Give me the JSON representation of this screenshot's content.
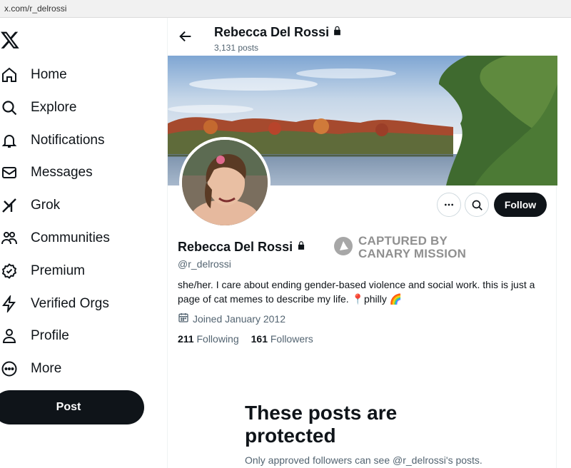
{
  "browser": {
    "url": "x.com/r_delrossi"
  },
  "sidebar": {
    "logo": "x-logo-icon",
    "items": [
      {
        "label": "Home",
        "icon": "home-icon"
      },
      {
        "label": "Explore",
        "icon": "search-icon"
      },
      {
        "label": "Notifications",
        "icon": "bell-icon"
      },
      {
        "label": "Messages",
        "icon": "envelope-icon"
      },
      {
        "label": "Grok",
        "icon": "grok-icon"
      },
      {
        "label": "Communities",
        "icon": "people-icon"
      },
      {
        "label": "Premium",
        "icon": "verified-badge-icon"
      },
      {
        "label": "Verified Orgs",
        "icon": "lightning-icon"
      },
      {
        "label": "Profile",
        "icon": "person-icon"
      },
      {
        "label": "More",
        "icon": "more-circle-icon"
      }
    ],
    "post_label": "Post"
  },
  "header": {
    "name": "Rebecca Del Rossi",
    "post_count": "3,131 posts"
  },
  "profile": {
    "display_name": "Rebecca Del Rossi",
    "handle": "@r_delrossi",
    "bio": "she/her. I care about ending gender-based violence and social work. this is just a page of cat memes to describe my life. 📍philly 🌈",
    "joined": "Joined January 2012",
    "following_count": "211",
    "following_label": "Following",
    "followers_count": "161",
    "followers_label": "Followers",
    "follow_label": "Follow"
  },
  "watermark": {
    "line1": "CAPTURED BY",
    "line2": "CANARY MISSION"
  },
  "protected": {
    "title": "These posts are protected",
    "subtitle": "Only approved followers can see @r_delrossi's posts."
  },
  "colors": {
    "text": "#0f1419",
    "muted": "#536471",
    "button": "#0f1419"
  }
}
